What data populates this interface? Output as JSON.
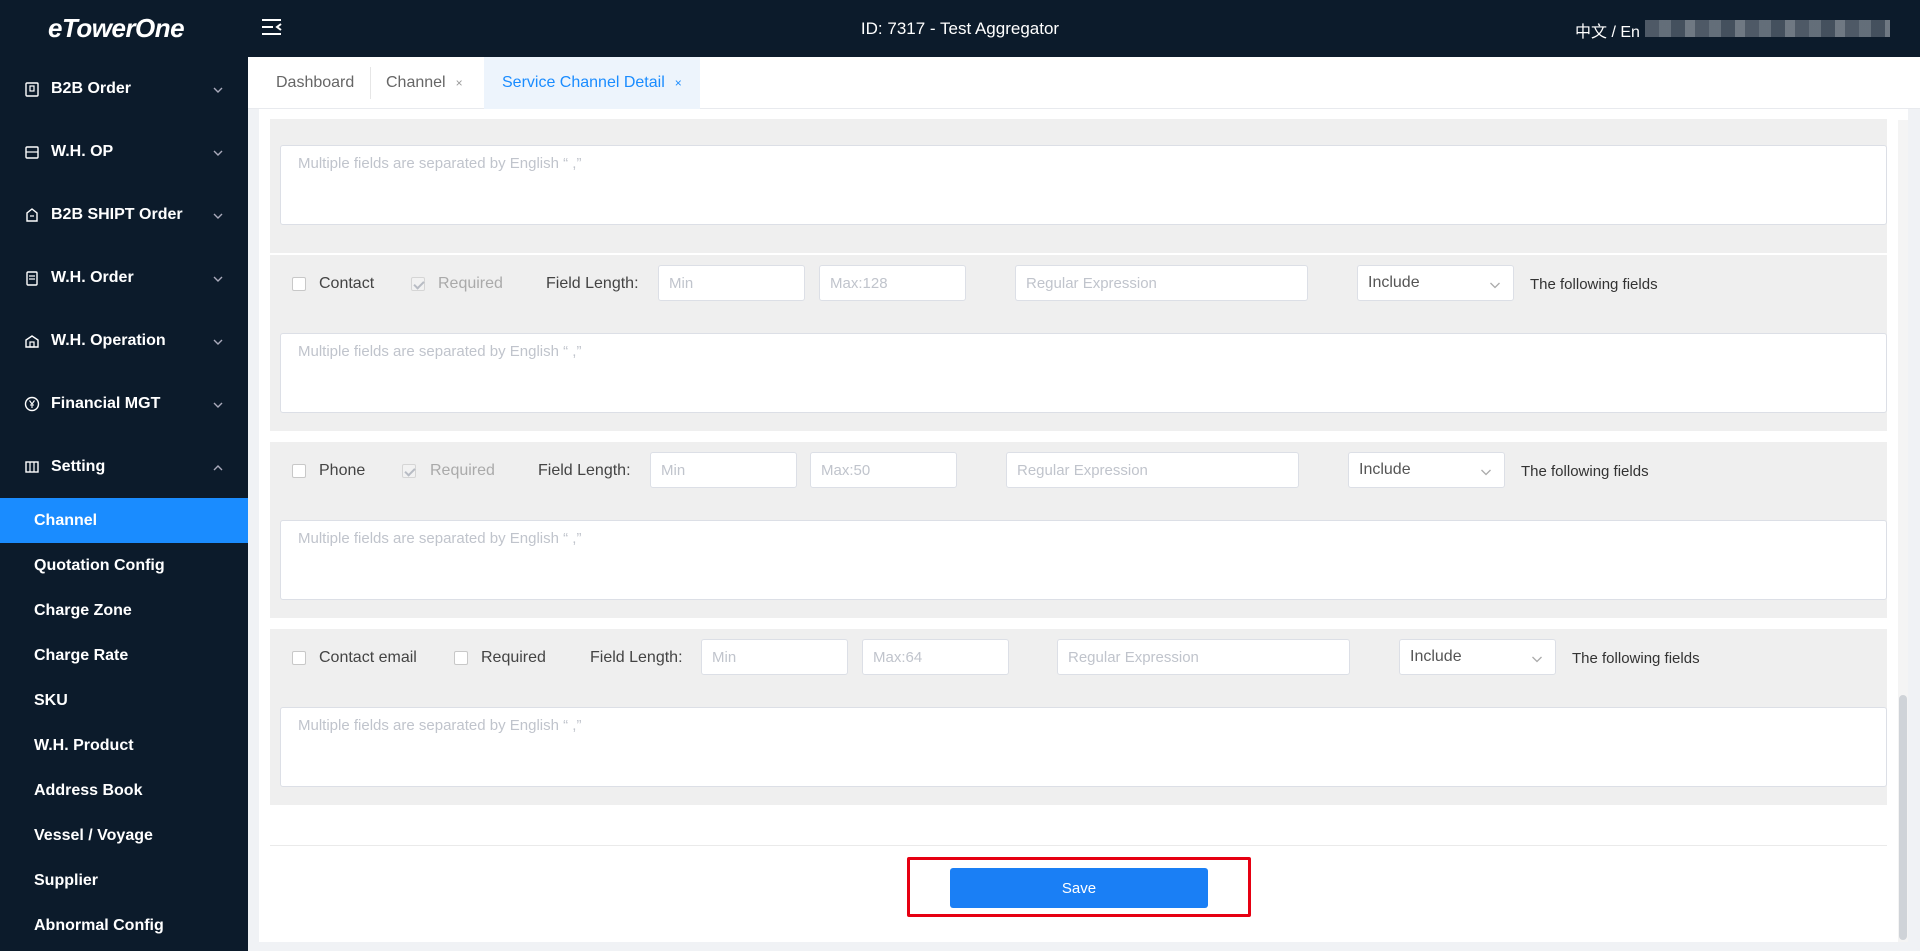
{
  "header": {
    "logo": "eTowerOne",
    "title": "ID: 7317 - Test Aggregator",
    "language": "中文 / En"
  },
  "sidebar": {
    "groups": [
      {
        "label": "B2B Order",
        "icon": "order-icon"
      },
      {
        "label": "W.H. OP",
        "icon": "warehouse-icon"
      },
      {
        "label": "B2B SHIPT Order",
        "icon": "shipment-icon"
      },
      {
        "label": "W.H. Order",
        "icon": "clipboard-icon"
      },
      {
        "label": "W.H. Operation",
        "icon": "building-icon"
      },
      {
        "label": "Financial MGT",
        "icon": "yuan-icon"
      },
      {
        "label": "Setting",
        "icon": "grid-icon"
      }
    ],
    "setting_items": [
      {
        "label": "Channel",
        "active": true
      },
      {
        "label": "Quotation Config"
      },
      {
        "label": "Charge Zone"
      },
      {
        "label": "Charge Rate"
      },
      {
        "label": "SKU"
      },
      {
        "label": "W.H. Product"
      },
      {
        "label": "Address Book"
      },
      {
        "label": "Vessel / Voyage"
      },
      {
        "label": "Supplier"
      },
      {
        "label": "Abnormal Config"
      }
    ]
  },
  "tabs": [
    {
      "label": "Dashboard"
    },
    {
      "label": "Channel",
      "close": "×"
    },
    {
      "label": "Service Channel Detail",
      "close": "×",
      "active": true
    }
  ],
  "form": {
    "textarea_placeholder": "Multiple fields are separated by English “ ,”",
    "rows": [
      {
        "field": "Contact",
        "required_label": "Required",
        "required_checked": true,
        "field_length_label": "Field Length:",
        "min_placeholder": "Min",
        "max_placeholder": "Max:128",
        "regex_placeholder": "Regular Expression",
        "match_mode": "Include",
        "following_label": "The following fields"
      },
      {
        "field": "Phone",
        "required_label": "Required",
        "required_checked": true,
        "field_length_label": "Field Length:",
        "min_placeholder": "Min",
        "max_placeholder": "Max:50",
        "regex_placeholder": "Regular Expression",
        "match_mode": "Include",
        "following_label": "The following fields"
      },
      {
        "field": "Contact email",
        "required_label": "Required",
        "required_checked": false,
        "field_length_label": "Field Length:",
        "min_placeholder": "Min",
        "max_placeholder": "Max:64",
        "regex_placeholder": "Regular Expression",
        "match_mode": "Include",
        "following_label": "The following fields"
      }
    ],
    "save_label": "Save"
  }
}
